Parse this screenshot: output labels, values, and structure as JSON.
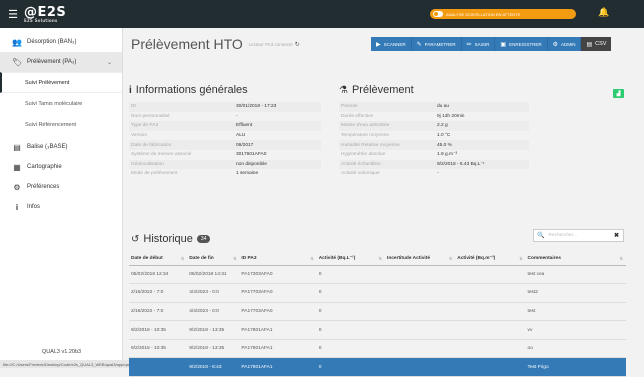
{
  "app": {
    "logo": "@E2S",
    "logo_sub": "E2S Solutions",
    "alert_text": "ANALYSE SCINTILLATION EN ATTENTE",
    "version": "QUAL3 v1.20b3",
    "status_url": "file:///C:/Users/Frederic/Desktop/Code/e2s_QUAL3_WEB/qual3/app/qa3.html#"
  },
  "sidebar": {
    "items": [
      {
        "label": "Désorption (BAN₃)",
        "icon": "user-icon"
      },
      {
        "label": "Prélèvement (PA₃)",
        "icon": "tag-icon"
      },
      {
        "label": "Balise (₃BASE)",
        "icon": "database-icon"
      },
      {
        "label": "Cartographie",
        "icon": "map-icon"
      },
      {
        "label": "Préférences",
        "icon": "gear-icon"
      },
      {
        "label": "Infos",
        "icon": "info-icon"
      }
    ],
    "sub_items": [
      "Suivi Prélèvement",
      "Suivi Tamis moléculaire",
      "Suivi Référencement"
    ]
  },
  "header": {
    "title": "Prélèvement HTO",
    "reader_status": "Lecteur PA3 connecté"
  },
  "toolbar": {
    "scanner": "SCANNER",
    "parametrer": "PARAMETRER",
    "saisir": "SAISIR",
    "enregistrer": "ENREGISTRER",
    "admin": "ADMIN",
    "csv": "CSV"
  },
  "info": {
    "title": "Informations générales",
    "rows": [
      {
        "k": "ID",
        "v": "30/01/2018 - 17:23"
      },
      {
        "k": "Nom personnalisé",
        "v": "-"
      },
      {
        "k": "Type de PA3",
        "v": "Effluent"
      },
      {
        "k": "Version",
        "v": "ALU"
      },
      {
        "k": "Date de fabrication",
        "v": "06/2017"
      },
      {
        "k": "Système de mesure associé",
        "v": "3017601AFA0"
      },
      {
        "k": "Géolocalisation",
        "v": "non disponible"
      },
      {
        "k": "Mode de prélèvement",
        "v": "1 semaine"
      }
    ]
  },
  "prelevement": {
    "title": "Prélèvement",
    "rows": [
      {
        "k": "Période",
        "v": "du  au"
      },
      {
        "k": "Durée effective",
        "v": "9j 13h 20min"
      },
      {
        "k": "Masse d'eau adsorbée",
        "v": "2.2 g"
      },
      {
        "k": "Température moyenne",
        "v": "1.0 °C"
      },
      {
        "k": "Humidité Relative moyenne",
        "v": "45.0 %"
      },
      {
        "k": "Hygrométrie absolue",
        "v": "1.9 g.m⁻³"
      },
      {
        "k": "Activité échantillon",
        "v": "9/2/2018 - 6.43 Bq.L⁻¹"
      },
      {
        "k": "Activité volumique",
        "v": "-"
      }
    ]
  },
  "historique": {
    "title": "Historique",
    "count": "34",
    "search_placeholder": "Rechercher...",
    "columns": [
      "Date de début",
      "Date de fin",
      "ID PA3",
      "Activité (Bq.L⁻¹)",
      "Incertitude Activité",
      "Activité (Bq.m⁻³)",
      "Commentaires"
    ],
    "rows": [
      [
        "05/02/2018 12:34",
        "05/02/2018 14:31",
        "PA17303AFA0",
        "0",
        "",
        "",
        "test cea"
      ],
      [
        "2/16/2022 - 7:0",
        "4/4/2023 - 0:0",
        "PA17703AFA0",
        "0",
        "",
        "",
        "test2"
      ],
      [
        "2/16/2022 - 7:0",
        "4/4/2023 - 0:0",
        "PA17703AFA0",
        "0",
        "",
        "",
        "test"
      ],
      [
        "9/2/2018 - 10:35",
        "9/2/2018 - 13:35",
        "PA17801AFA1",
        "0",
        "",
        "",
        "vv"
      ],
      [
        "9/2/2018 - 10:35",
        "9/2/2018 - 13:35",
        "PA17801AFA1",
        "0",
        "",
        "",
        "oo"
      ],
      [
        "",
        "9/2/2018 - 6:43",
        "PA17801AFA1",
        "0",
        "",
        "",
        "Test Frigo"
      ]
    ]
  }
}
